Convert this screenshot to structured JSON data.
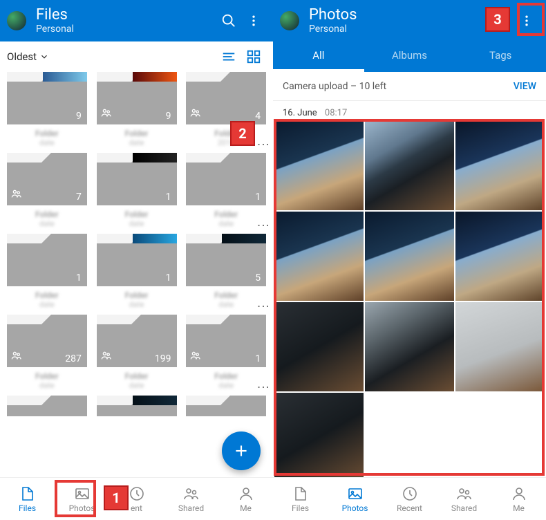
{
  "left": {
    "title": "Files",
    "subtitle": "Personal",
    "sort": "Oldest",
    "folders": [
      [
        {
          "count": "9",
          "shared": false,
          "preview": "blue"
        },
        {
          "count": "9",
          "shared": true,
          "preview": "red"
        },
        {
          "count": "4",
          "shared": true,
          "preview": "none",
          "date": "2016"
        }
      ],
      [
        {
          "count": "7",
          "shared": true,
          "preview": "none"
        },
        {
          "count": "1",
          "shared": false,
          "preview": "black"
        },
        {
          "count": "1",
          "shared": false,
          "preview": "none"
        }
      ],
      [
        {
          "count": "1",
          "shared": false,
          "preview": "none"
        },
        {
          "count": "1",
          "shared": false,
          "preview": "cyan"
        },
        {
          "count": "5",
          "shared": false,
          "preview": "dark"
        }
      ],
      [
        {
          "count": "287",
          "shared": true,
          "preview": "none"
        },
        {
          "count": "199",
          "shared": true,
          "preview": "none"
        },
        {
          "count": "1",
          "shared": true,
          "preview": "none"
        }
      ]
    ],
    "nav": [
      "Files",
      "Photos",
      "ent",
      "Shared",
      "Me"
    ],
    "nav_active": 0
  },
  "right": {
    "title": "Photos",
    "subtitle": "Personal",
    "tabs": [
      "All",
      "Albums",
      "Tags"
    ],
    "tab_active": 0,
    "banner_text": "Camera upload – 10 left",
    "banner_action": "VIEW",
    "date_day": "16. June",
    "date_time": "08:17",
    "nav": [
      "Files",
      "Photos",
      "Recent",
      "Shared",
      "Me"
    ],
    "nav_active": 1
  },
  "callouts": {
    "c1": "1",
    "c2": "2",
    "c3": "3"
  }
}
